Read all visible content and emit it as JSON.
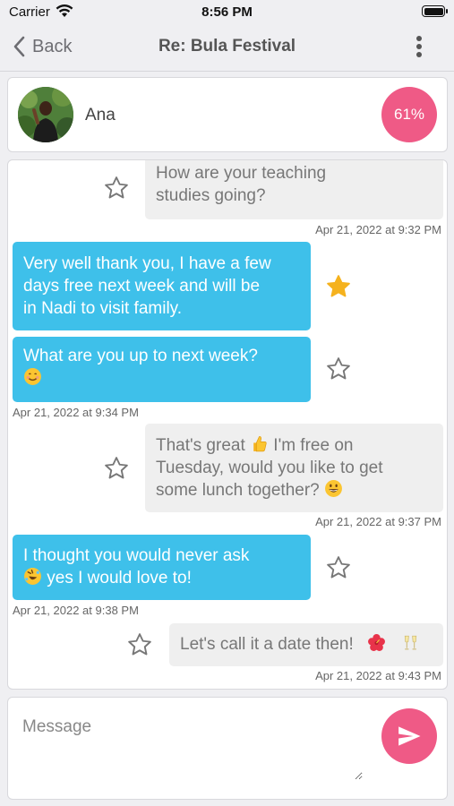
{
  "status_bar": {
    "carrier": "Carrier",
    "time": "8:56 PM"
  },
  "nav": {
    "back_label": "Back",
    "title": "Re: Bula Festival"
  },
  "profile": {
    "name": "Ana",
    "match": "61%"
  },
  "messages": [
    {
      "direction": "incoming",
      "lines": [
        "How are your teaching",
        "studies going?"
      ],
      "starred": false,
      "timestamp": "Apr 21, 2022 at 9:32 PM"
    },
    {
      "direction": "outgoing",
      "lines": [
        "Very well thank you, I have a few",
        "days free next week and will be",
        "in Nadi to visit family."
      ],
      "starred": true
    },
    {
      "direction": "outgoing",
      "lines": [
        "What are you up to next week?",
        ""
      ],
      "starred": false,
      "timestamp": "Apr 21, 2022 at 9:34 PM"
    },
    {
      "direction": "incoming",
      "lines": [
        "That's great",
        " I'm free on",
        "Tuesday, would you like to get",
        "some lunch together?"
      ],
      "starred": false,
      "timestamp": "Apr 21, 2022 at 9:37 PM"
    },
    {
      "direction": "outgoing",
      "lines": [
        "I thought you would never ask",
        " yes I would love to!"
      ],
      "starred": false,
      "timestamp": "Apr 21, 2022 at 9:38 PM"
    },
    {
      "direction": "incoming",
      "lines": [
        "Let's call it a date then!"
      ],
      "starred": false,
      "timestamp": "Apr 21, 2022 at 9:43 PM"
    }
  ],
  "composer": {
    "placeholder": "Message"
  },
  "colors": {
    "accent": "#ef5a86",
    "outgoing_bubble": "#3ec0ea",
    "incoming_bubble": "#efefef",
    "star_active": "#f5b21e"
  },
  "icons": [
    "wifi-icon",
    "battery-icon",
    "back-chevron-icon",
    "more-vertical-icon",
    "star-outline-icon",
    "star-filled-icon",
    "send-icon"
  ]
}
